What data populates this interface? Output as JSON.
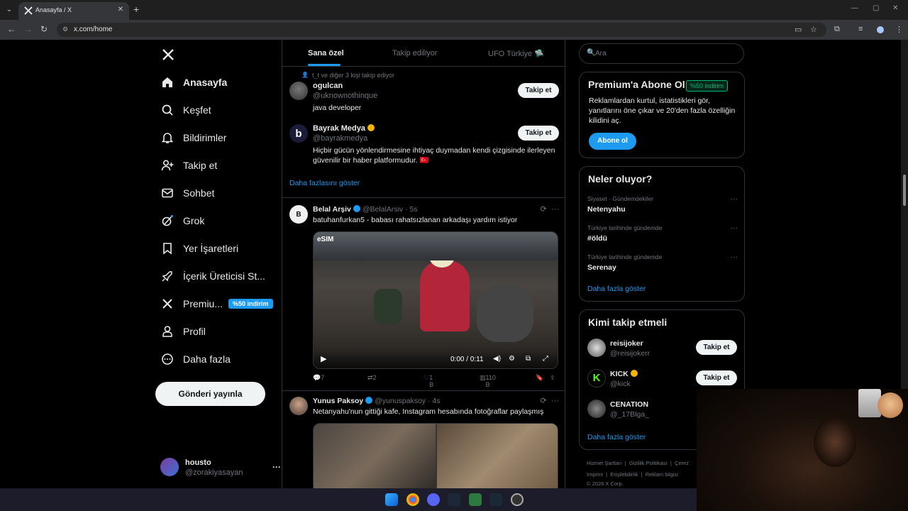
{
  "browser": {
    "tab_title": "Anasayfa / X",
    "url": "x.com/home"
  },
  "left_nav": {
    "items": [
      {
        "label": "Anasayfa",
        "icon": "home-icon"
      },
      {
        "label": "Keşfet",
        "icon": "search-icon"
      },
      {
        "label": "Bildirimler",
        "icon": "bell-icon"
      },
      {
        "label": "Takip et",
        "icon": "add-user-icon"
      },
      {
        "label": "Sohbet",
        "icon": "mail-icon"
      },
      {
        "label": "Grok",
        "icon": "grok-icon"
      },
      {
        "label": "Yer İşaretleri",
        "icon": "bookmark-icon"
      },
      {
        "label": "İçerik Üreticisi St...",
        "icon": "rocket-icon"
      },
      {
        "label": "Premiu...",
        "icon": "x-logo-icon",
        "badge": "%50 indirim"
      },
      {
        "label": "Profil",
        "icon": "profile-icon"
      },
      {
        "label": "Daha fazla",
        "icon": "more-circle-icon"
      }
    ],
    "post_button": "Gönderi yayınla",
    "account": {
      "name": "housto",
      "handle": "@zorakiyasayan"
    }
  },
  "feed": {
    "tabs": [
      "Sana özel",
      "Takip ediliyor",
      "UFO Türkiye 🛸"
    ],
    "suggestion_header": "t_t ve diğer 3 kişi takip ediyor",
    "suggestions": [
      {
        "name": "ogulcan",
        "handle": "@uknownothinque",
        "bio": "java developer",
        "button": "Takip et"
      },
      {
        "name": "Bayrak Medya",
        "handle": "@bayrakmedya",
        "bio": "Hiçbir gücün yönlendirmesine ihtiyaç duymadan kendi çizgisinde ilerleyen güvenilir bir haber platformudur. 🇹🇷",
        "button": "Takip et"
      }
    ],
    "show_more": "Daha fazlasını göster",
    "tweets": [
      {
        "name": "Belal Arşiv",
        "handle": "@BelalArsiv · 5s",
        "text": "batuhanfurkan5 - babası rahatsızlanan arkadaşı yardım istiyor",
        "video_label": "eSIM",
        "video_time": "0:00 / 0:11",
        "replies": "7",
        "reposts": "2",
        "likes": "1 B",
        "views": "110 B"
      },
      {
        "name": "Yunus Paksoy",
        "handle": "@yunuspaksoy · 4s",
        "text": "Netanyahu'nun gittiği kafe, Instagram hesabında fotoğraflar paylaşmış"
      }
    ]
  },
  "right": {
    "search_placeholder": "Ara",
    "premium": {
      "title": "Premium'a Abone Ol",
      "badge": "%50 indirim",
      "desc": "Reklamlardan kurtul, istatistikleri gör, yanıtlarını öne çıkar ve 20'den fazla özelliğin kilidini aç.",
      "button": "Abone ol"
    },
    "trends": {
      "title": "Neler oluyor?",
      "items": [
        {
          "context": "Siyaset · Gündemdekiler",
          "name": "Netenyahu"
        },
        {
          "context": "Türkiye tarihinde gündemde",
          "name": "#öldü"
        },
        {
          "context": "Türkiye tarihinde gündemde",
          "name": "Serenay"
        }
      ],
      "more": "Daha fazla göster"
    },
    "who_to_follow": {
      "title": "Kimi takip etmeli",
      "items": [
        {
          "name": "reisijoker",
          "handle": "@reisijokerr",
          "button": "Takip et"
        },
        {
          "name": "KICK",
          "handle": "@kick",
          "button": "Takip et"
        },
        {
          "name": "CENATION",
          "handle": "@_17Blga_"
        }
      ],
      "more": "Daha fazla göster"
    },
    "footer": {
      "row1": [
        "Hizmet Şartları",
        "Gizlilik Politikası",
        "Çerez"
      ],
      "row2": [
        "Imprint",
        "Erişilebilirlik",
        "Reklam bilgisi"
      ],
      "copyright": "© 2026 X Corp."
    }
  },
  "colors": {
    "accent": "#1d9bf0",
    "background": "#000000",
    "border": "#2f3336",
    "muted": "#71767b"
  }
}
